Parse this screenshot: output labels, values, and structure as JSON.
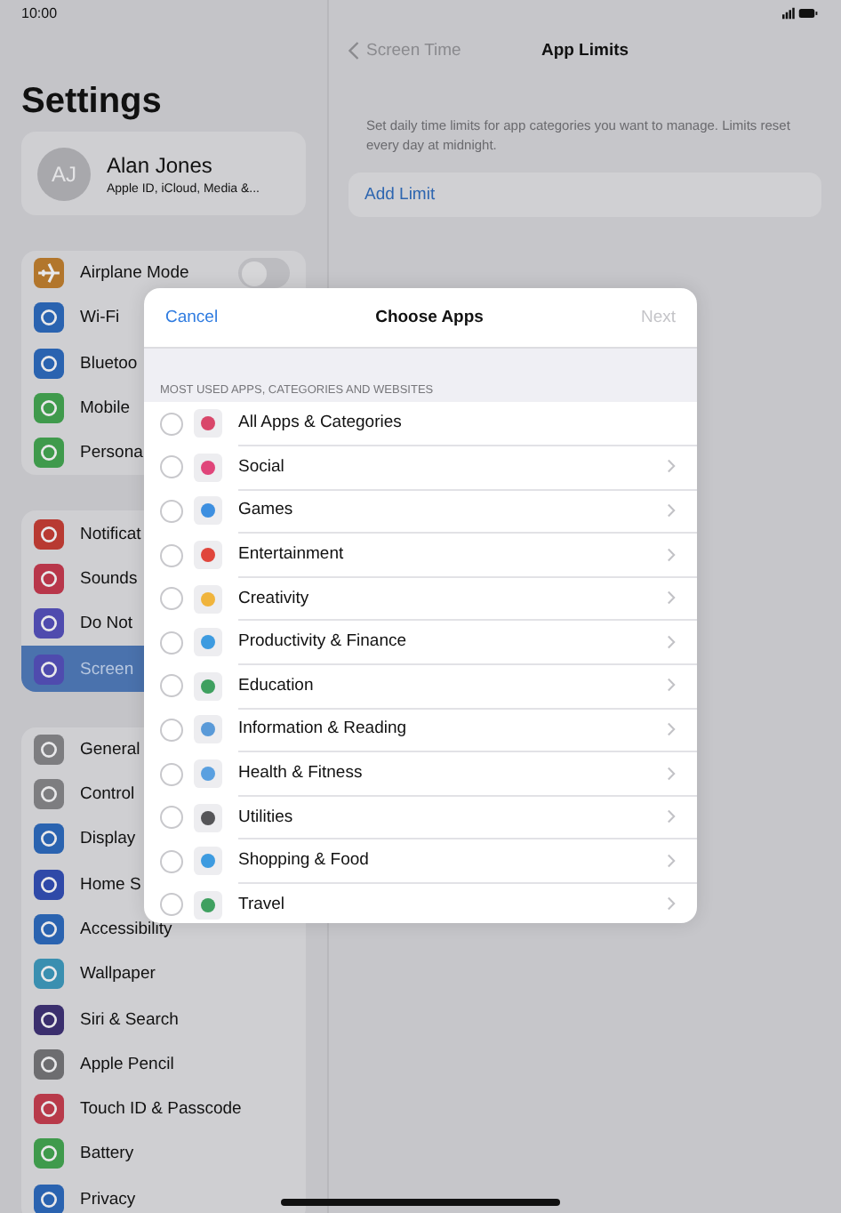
{
  "status_bar": {
    "time": "10:00"
  },
  "sidebar": {
    "title": "Settings",
    "profile": {
      "initials": "AJ",
      "name": "Alan Jones",
      "subtitle": "Apple ID, iCloud, Media &..."
    },
    "groups": [
      {
        "items": [
          {
            "label": "Airplane Mode",
            "color": "#b2762c",
            "kind": "toggle",
            "on": false,
            "selected": false
          },
          {
            "label": "Wi-Fi",
            "color": "#2a63b0",
            "kind": "link",
            "selected": false
          },
          {
            "label": "Bluetoo",
            "color": "#2a63b0",
            "kind": "link",
            "selected": false
          },
          {
            "label": "Mobile",
            "color": "#3f9a4c",
            "kind": "link",
            "selected": false
          },
          {
            "label": "Persona",
            "color": "#3f9a4c",
            "kind": "link",
            "selected": false
          }
        ]
      },
      {
        "items": [
          {
            "label": "Notificat",
            "color": "#b83a32",
            "kind": "link",
            "selected": false
          },
          {
            "label": "Sounds",
            "color": "#b8364a",
            "kind": "link",
            "selected": false
          },
          {
            "label": "Do Not",
            "color": "#4f4bae",
            "kind": "link",
            "selected": false
          },
          {
            "label": "Screen",
            "color": "#4f4bae",
            "kind": "link",
            "selected": true
          }
        ]
      },
      {
        "items": [
          {
            "label": "General",
            "color": "#7d7d80",
            "kind": "link",
            "selected": false
          },
          {
            "label": "Control",
            "color": "#7d7d80",
            "kind": "link",
            "selected": false
          },
          {
            "label": "Display",
            "color": "#2a63b0",
            "kind": "link",
            "selected": false
          },
          {
            "label": "Home S",
            "color": "#2f49a8",
            "kind": "link",
            "selected": false
          },
          {
            "label": "Accessibility",
            "color": "#2a63b0",
            "kind": "link",
            "selected": false
          },
          {
            "label": "Wallpaper",
            "color": "#3a8fb0",
            "kind": "link",
            "selected": false
          },
          {
            "label": "Siri & Search",
            "color": "#3b2f6e",
            "kind": "link",
            "selected": false
          },
          {
            "label": "Apple Pencil",
            "color": "#6d6d70",
            "kind": "link",
            "selected": false
          },
          {
            "label": "Touch ID & Passcode",
            "color": "#b83a4a",
            "kind": "link",
            "selected": false
          },
          {
            "label": "Battery",
            "color": "#3f9a4c",
            "kind": "link",
            "selected": false
          },
          {
            "label": "Privacy",
            "color": "#2a63b0",
            "kind": "link",
            "selected": false
          }
        ]
      }
    ]
  },
  "detail": {
    "back_label": "Screen Time",
    "title": "App Limits",
    "description": "Set daily time limits for app categories you want to manage. Limits reset every day at midnight.",
    "add_button": "Add Limit"
  },
  "modal": {
    "cancel": "Cancel",
    "title": "Choose Apps",
    "next": "Next",
    "next_disabled": true,
    "section_header": "MOST USED APPS, CATEGORIES AND WEBSITES",
    "rows": [
      {
        "label": "All Apps & Categories",
        "color": "#d9476a",
        "selected": false,
        "chevron": false
      },
      {
        "label": "Social",
        "color": "#e0457a",
        "selected": false,
        "chevron": true
      },
      {
        "label": "Games",
        "color": "#3d8fe0",
        "selected": false,
        "chevron": true
      },
      {
        "label": "Entertainment",
        "color": "#e0463c",
        "selected": false,
        "chevron": true
      },
      {
        "label": "Creativity",
        "color": "#f0b43c",
        "selected": false,
        "chevron": true
      },
      {
        "label": "Productivity & Finance",
        "color": "#3d9be0",
        "selected": false,
        "chevron": true
      },
      {
        "label": "Education",
        "color": "#3fa060",
        "selected": false,
        "chevron": true
      },
      {
        "label": "Information & Reading",
        "color": "#5a9ad8",
        "selected": false,
        "chevron": true
      },
      {
        "label": "Health & Fitness",
        "color": "#5aa0e0",
        "selected": false,
        "chevron": true
      },
      {
        "label": "Utilities",
        "color": "#555558",
        "selected": false,
        "chevron": true
      },
      {
        "label": "Shopping & Food",
        "color": "#3d9be0",
        "selected": false,
        "chevron": true
      },
      {
        "label": "Travel",
        "color": "#3fa060",
        "selected": false,
        "chevron": true
      }
    ]
  }
}
